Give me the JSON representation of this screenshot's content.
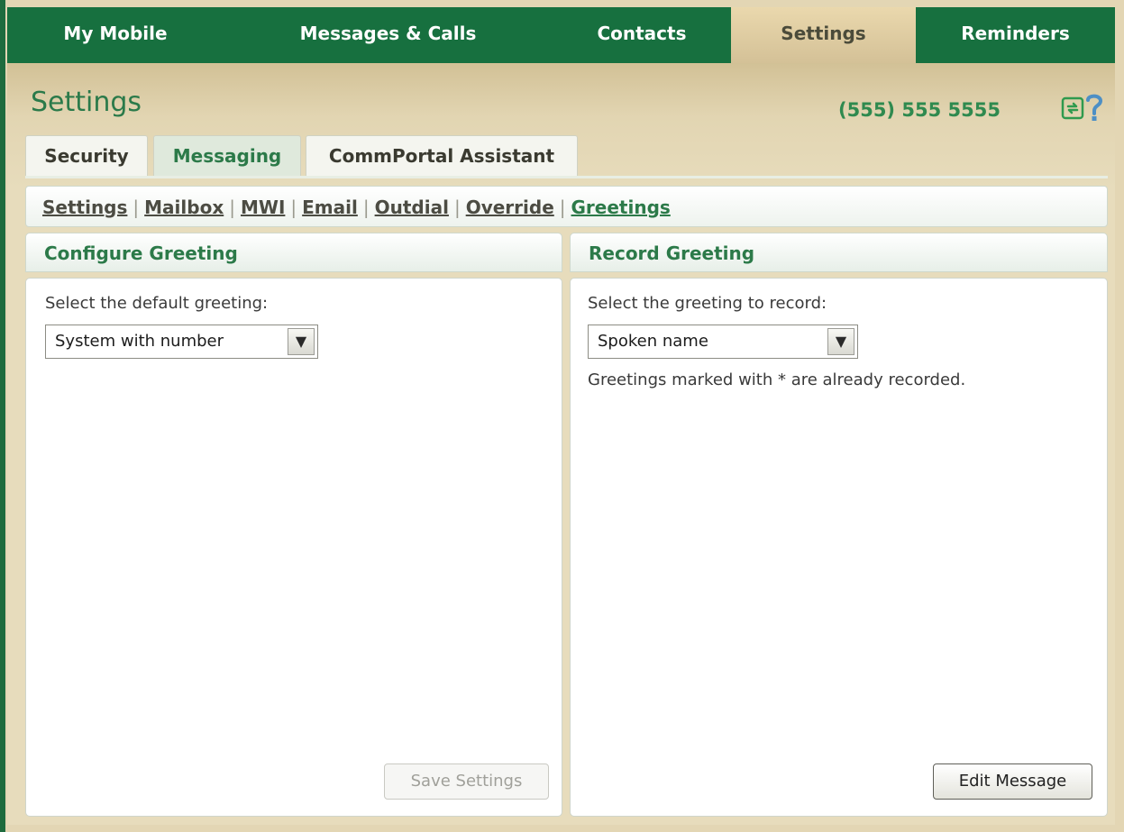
{
  "topnav": {
    "tabs": [
      "My Mobile",
      "Messages & Calls",
      "Contacts",
      "Settings",
      "Reminders"
    ],
    "active": "Settings"
  },
  "header": {
    "title": "Settings",
    "phone": "(555) 555 5555",
    "refresh_icon": "refresh-icon",
    "help_icon": "help-icon"
  },
  "subtabs": {
    "items": [
      "Security",
      "Messaging",
      "CommPortal Assistant"
    ],
    "active": "Messaging"
  },
  "links": {
    "items": [
      "Settings",
      "Mailbox",
      "MWI",
      "Email",
      "Outdial",
      "Override",
      "Greetings"
    ],
    "current": "Greetings"
  },
  "configure": {
    "heading": "Configure Greeting",
    "label": "Select the default greeting:",
    "selected": "System with number",
    "save_label": "Save Settings"
  },
  "record": {
    "heading": "Record Greeting",
    "label": "Select the greeting to record:",
    "selected": "Spoken name",
    "note": "Greetings marked with * are already recorded.",
    "edit_label": "Edit Message"
  },
  "colors": {
    "nav_green": "#17703f",
    "accent_green": "#2c7a49",
    "tan": "#e3d6b4"
  }
}
